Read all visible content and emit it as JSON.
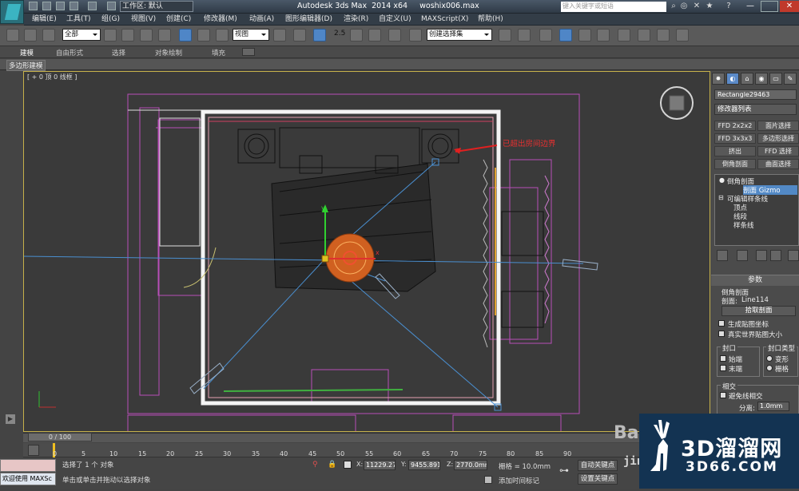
{
  "titlebar": {
    "workspace": "工作区: 默认",
    "title": "Autodesk 3ds Max  2014 x64     woshix006.max",
    "search_placeholder": "键入关键字或短语",
    "quick_icons": [
      "new-icon",
      "open-icon",
      "save-icon",
      "undo-icon",
      "redo-icon",
      "project-icon"
    ],
    "right_icons": [
      "search-icon",
      "binoculars-icon",
      "exchange-icon",
      "star-icon",
      "help-icon"
    ]
  },
  "menu": [
    "编辑(E)",
    "工具(T)",
    "组(G)",
    "视图(V)",
    "创建(C)",
    "修改器(M)",
    "动画(A)",
    "图形编辑器(D)",
    "渲染(R)",
    "自定义(U)",
    "MAXScript(X)",
    "帮助(H)"
  ],
  "toolbar": {
    "filter": "全部",
    "coord_system": "视图",
    "named_selection": "创建选择集",
    "snap_label": "2.5"
  },
  "ribbon": {
    "tabs": [
      "建模",
      "自由形式",
      "选择",
      "对象绘制",
      "填充"
    ],
    "panel_button": "多边形建模"
  },
  "viewport": {
    "label": "[ + 0 顶 0 线框 ]",
    "annotation": "已超出房间边界",
    "axis_y": "y",
    "axis_x": "x"
  },
  "command_panel": {
    "object_name": "Rectangle29463",
    "modifier_list": "修改器列表",
    "modifier_buttons": [
      "FFD 2x2x2",
      "面片选择",
      "FFD 3x3x3",
      "多边形选择",
      "挤出",
      "FFD 选择",
      "倒角剖面",
      "曲面选择"
    ],
    "stack": [
      {
        "label": "倒角剖面",
        "selected": false
      },
      {
        "label": "剖面 Gizmo",
        "selected": true
      },
      {
        "label": "可编辑样条线",
        "selected": false
      },
      {
        "label": "顶点",
        "selected": false
      },
      {
        "label": "线段",
        "selected": false
      },
      {
        "label": "样条线",
        "selected": false
      }
    ],
    "params": {
      "header": "参数",
      "section": "倒角剖面",
      "profile_label": "剖面:",
      "profile_value": "Line114",
      "pick_button": "拾取剖面",
      "gen_map": "生成贴图坐标",
      "real_world": "真实世界贴图大小",
      "cap_group": "封口",
      "cap_start": "始端",
      "cap_end": "末端",
      "cap_type_group": "封口类型",
      "cap_morph": "变形",
      "cap_grid": "栅格",
      "intersect_group": "相交",
      "avoid_self": "避免线相交",
      "separation_label": "分离:",
      "separation_value": "1.0mm"
    }
  },
  "timeline": {
    "frame": "0 / 100",
    "ticks": [
      "0",
      "5",
      "10",
      "15",
      "20",
      "25",
      "30",
      "35",
      "40",
      "45",
      "50",
      "55",
      "60",
      "65",
      "70",
      "75",
      "80",
      "85",
      "90"
    ]
  },
  "status": {
    "welcome": "欢迎使用 MAXSc",
    "selected": "选择了 1 个 对象",
    "prompt": "单击或单击并拖动以选择对象",
    "x_label": "X:",
    "x_value": "11229.278",
    "y_label": "Y:",
    "y_value": "9455.891m",
    "z_label": "Z:",
    "z_value": "2770.0mm",
    "grid": "栅格 = 10.0mm",
    "time_tag": "添加时间标记",
    "auto_key": "自动关键点",
    "set_key": "设置关键点"
  },
  "watermark": {
    "brand": "3D溜溜网",
    "url": "3D66.COM",
    "baidu": "Ba",
    "jingyan": "jing"
  }
}
